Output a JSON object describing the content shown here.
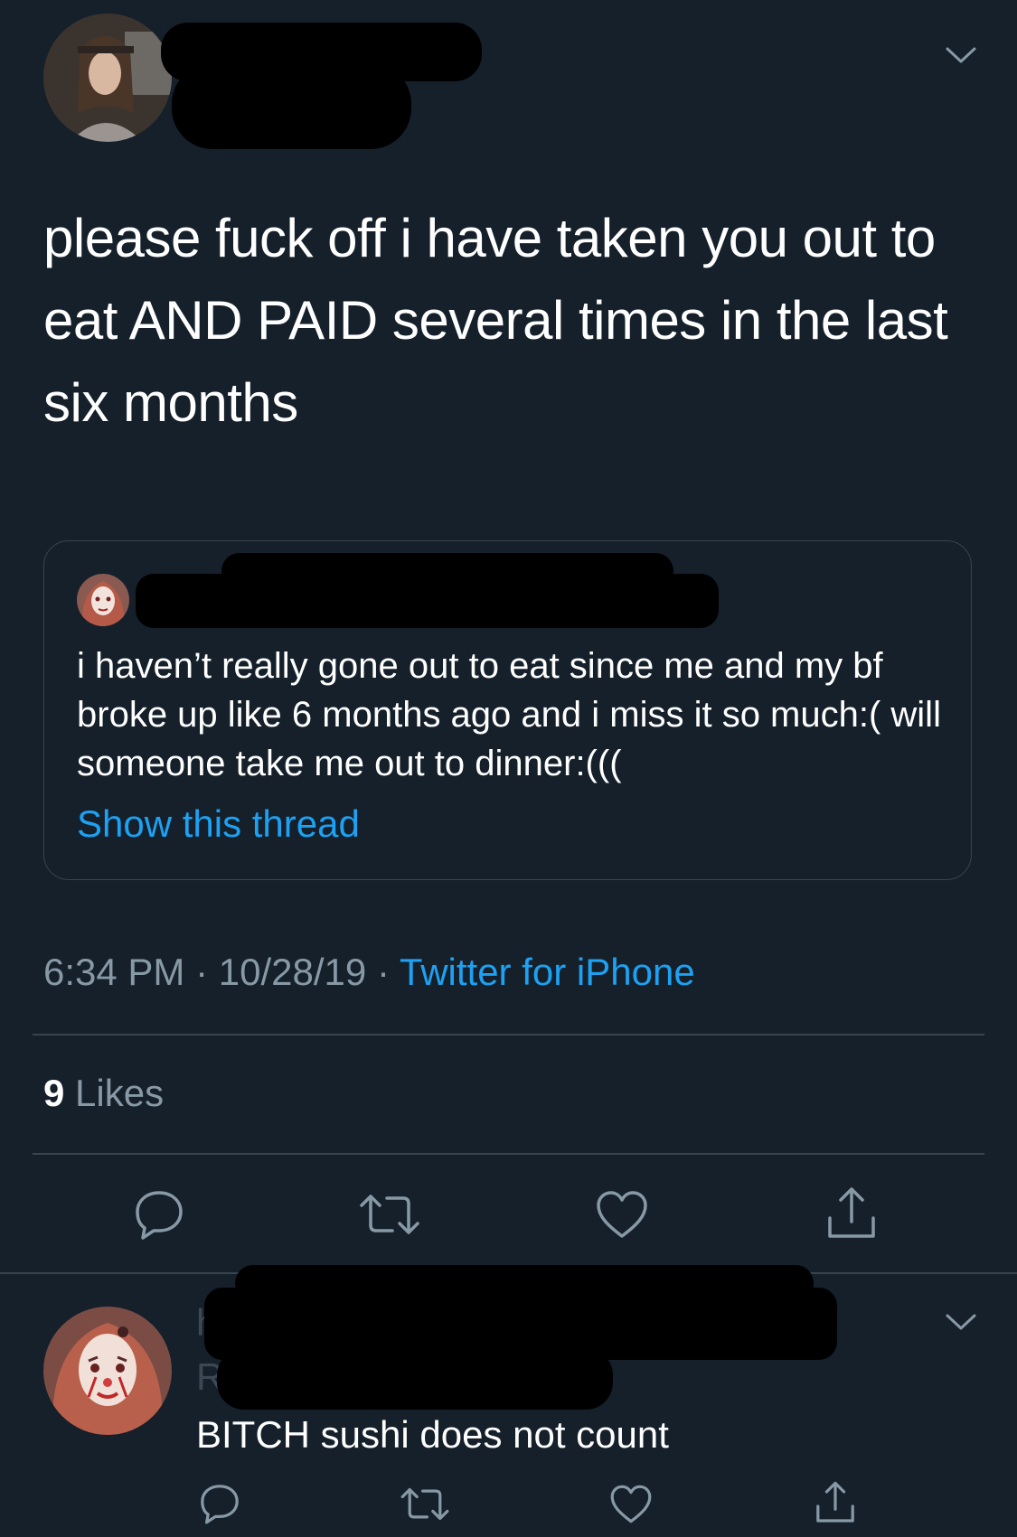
{
  "tweet": {
    "text": "please fuck off i have taken you out to eat AND PAID several times in the last six months",
    "quoted": {
      "text": "i haven’t really gone out to eat since me and my bf broke up like 6 months ago and i miss it so much:( will someone take me out to dinner:(((",
      "show_thread": "Show this thread"
    },
    "time": "6:34 PM",
    "date": "10/28/19",
    "separator": "·",
    "source": "Twitter for iPhone",
    "likes_count": "9",
    "likes_label": "Likes"
  },
  "reply": {
    "text": "BITCH sushi does not count"
  },
  "icons": {
    "menu": "chevron-down-icon",
    "reply": "reply-icon",
    "retweet": "retweet-icon",
    "like": "heart-icon",
    "share": "share-icon"
  },
  "colors": {
    "background": "#15202b",
    "accent": "#1da1f2",
    "secondary_text": "#8899a6",
    "divider": "#38444d"
  }
}
